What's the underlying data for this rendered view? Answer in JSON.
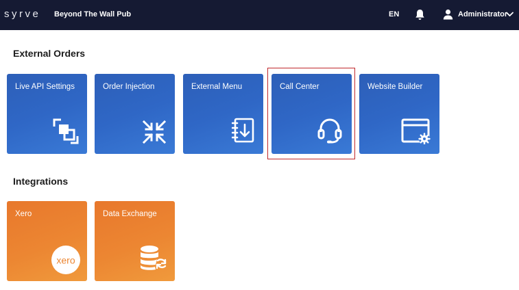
{
  "header": {
    "logo_text": "syrve",
    "venue_name": "Beyond The Wall Pub",
    "language": "EN",
    "user_name": "Administrator",
    "icons": [
      "bell-icon",
      "user-icon",
      "chevron-down-icon"
    ]
  },
  "sections": [
    {
      "title": "External Orders",
      "tiles": [
        {
          "label": "Live API Settings",
          "icon": "expand-squares-icon"
        },
        {
          "label": "Order Injection",
          "icon": "compress-arrows-icon"
        },
        {
          "label": "External Menu",
          "icon": "menu-book-download-icon"
        },
        {
          "label": "Call Center",
          "icon": "headset-icon"
        },
        {
          "label": "Website Builder",
          "icon": "browser-settings-icon"
        }
      ]
    },
    {
      "title": "Integrations",
      "tiles": [
        {
          "label": "Xero",
          "icon": "xero-logo",
          "logo_text": "xero"
        },
        {
          "label": "Data Exchange",
          "icon": "database-sync-icon"
        }
      ]
    }
  ],
  "colors": {
    "header_bg": "#151a33",
    "tile_blue": "#2f67c6",
    "tile_orange": "#ec8632",
    "highlight_border": "#c0262a"
  },
  "highlighted_tile": "Call Center"
}
